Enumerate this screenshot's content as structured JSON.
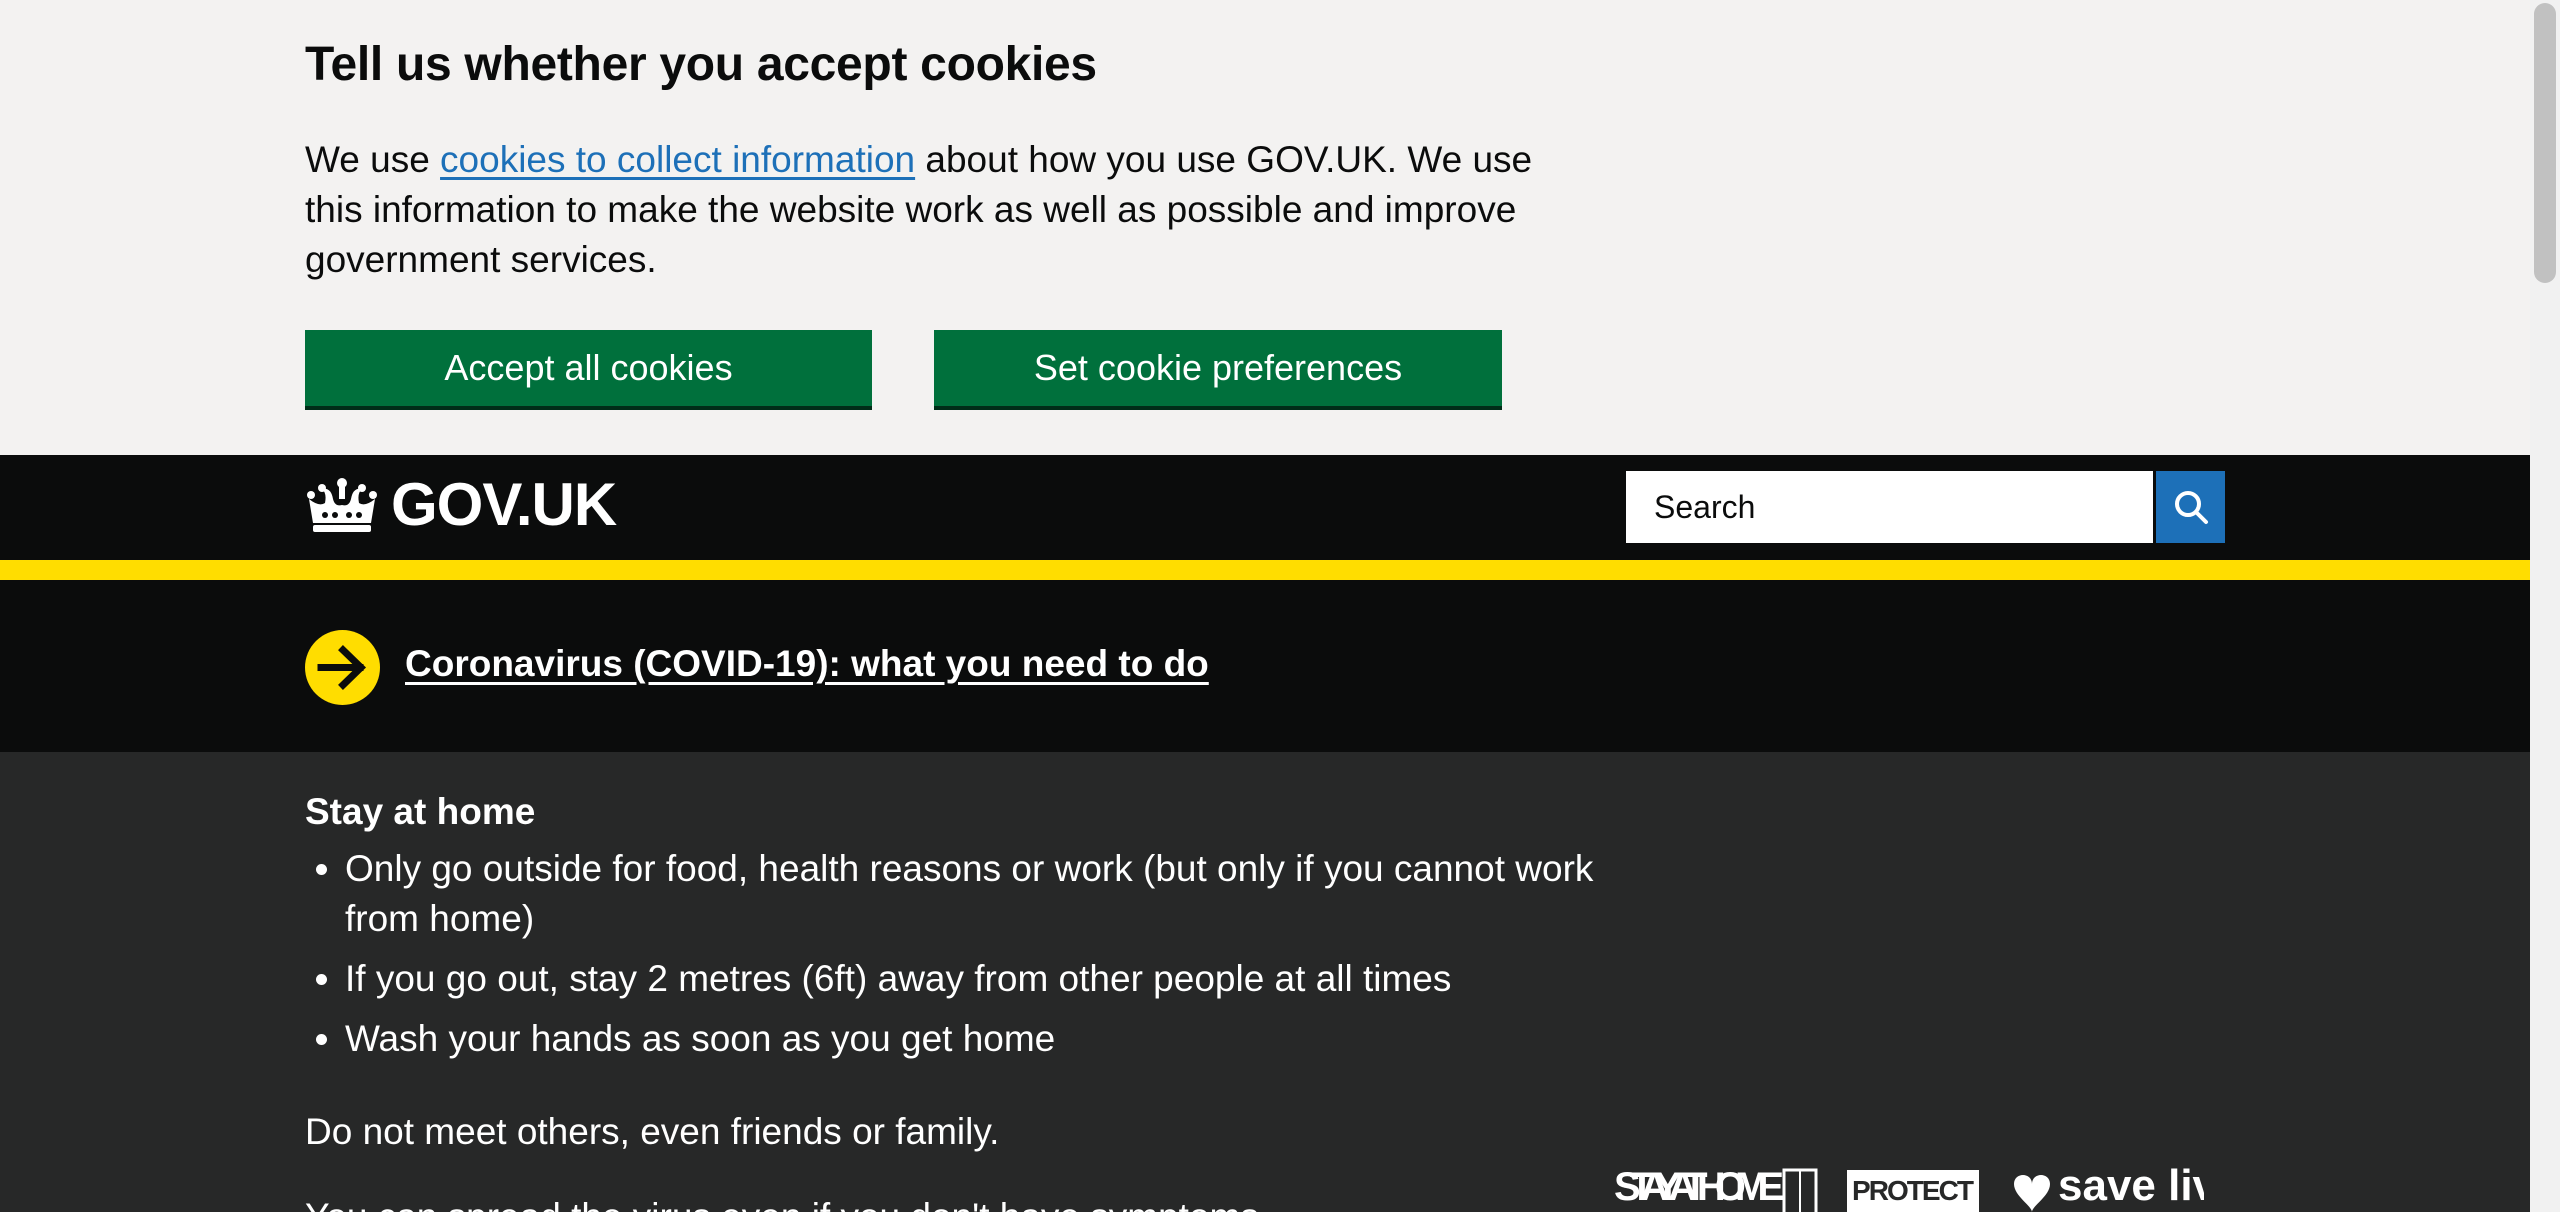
{
  "cookie_banner": {
    "title": "Tell us whether you accept cookies",
    "text_before_link": "We use ",
    "link_text": "cookies to collect information",
    "text_after_link": " about how you use GOV.UK. We use this information to make the website work as well as possible and improve government services.",
    "accept_label": "Accept all cookies",
    "preferences_label": "Set cookie preferences",
    "button_color": "#00703c"
  },
  "header": {
    "logo_text": "GOV.UK",
    "logo_icon": "crown-icon",
    "search_placeholder": "Search",
    "search_icon": "search-icon",
    "accent_color": "#1d70b8",
    "stripe_color": "#ffdd00"
  },
  "covid": {
    "arrow_icon": "arrow-right-circle-icon",
    "link_text": "Coronavirus (COVID-19): what you need to do"
  },
  "guidance": {
    "heading": "Stay at home",
    "items": [
      "Only go outside for food, health reasons or work (but only if you cannot work from home)",
      "If you go out, stay 2 metres (6ft) away from other people at all times",
      "Wash your hands as soon as you get home"
    ],
    "paragraph": "Do not meet others, even friends or family.",
    "paragraph_2": "You can spread the virus even if you don't have symptoms."
  },
  "campaign": {
    "image_name": "stay-at-home-protect-nhs-save-lives-logo",
    "text_1": "STAY AT HOME",
    "text_2": "PROTECT",
    "text_3": "save lives"
  }
}
